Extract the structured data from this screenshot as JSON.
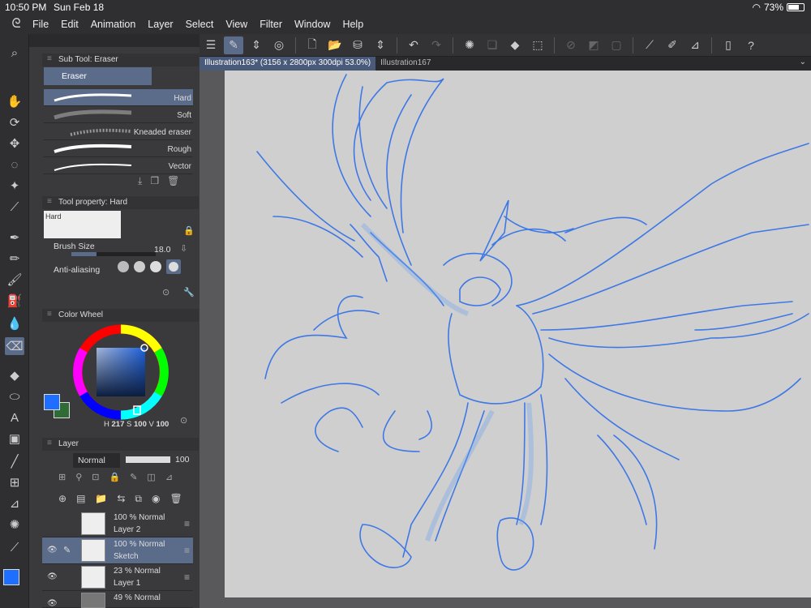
{
  "status": {
    "time": "10:50 PM",
    "date": "Sun Feb 18",
    "battery": "73%"
  },
  "menu": [
    "File",
    "Edit",
    "Animation",
    "Layer",
    "Select",
    "View",
    "Filter",
    "Window",
    "Help"
  ],
  "tabs": [
    "Illustration163* (3156 x 2800px 300dpi 53.0%)",
    "Illustration167"
  ],
  "subtool": {
    "header": "Sub Tool: Eraser",
    "group": "Eraser",
    "brushes": [
      "Hard",
      "Soft",
      "Kneaded eraser",
      "Rough",
      "Vector"
    ],
    "selected": "Hard"
  },
  "property": {
    "header": "Tool property: Hard",
    "preview_label": "Hard",
    "brush_size_label": "Brush Size",
    "brush_size": "18.0",
    "antialias_label": "Anti-aliasing"
  },
  "colorwheel": {
    "header": "Color Wheel",
    "h": "217",
    "s": "100",
    "v": "100",
    "h_label": "H",
    "s_label": "S",
    "v_label": "V",
    "main_color": "#1e6fff",
    "sub_color": "#2f6b35"
  },
  "layer": {
    "header": "Layer",
    "blend": "Normal",
    "opacity": "100",
    "rows": [
      {
        "opacity": "100 %",
        "blend": "Normal",
        "name": "Layer 2"
      },
      {
        "opacity": "100 %",
        "blend": "Normal",
        "name": "Sketch"
      },
      {
        "opacity": "23 %",
        "blend": "Normal",
        "name": "Layer 1"
      },
      {
        "opacity": "49 %",
        "blend": "Normal",
        "name": ""
      }
    ]
  },
  "colors": {
    "accent": "#5b6b8a",
    "stroke": "#2f6fe8",
    "canvas": "#cfcfd0"
  }
}
